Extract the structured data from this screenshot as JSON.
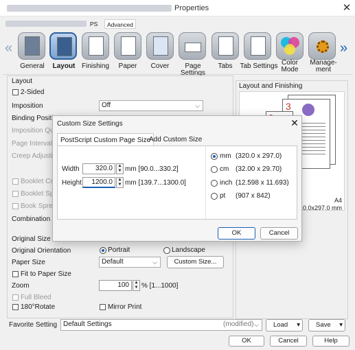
{
  "window": {
    "title": "Properties",
    "close": "✕"
  },
  "top_tabs": [
    "PS",
    "Advanced"
  ],
  "icons": [
    {
      "label": "General",
      "icon": "general-icon"
    },
    {
      "label": "Layout",
      "icon": "layout-icon",
      "selected": true
    },
    {
      "label": "Finishing",
      "icon": "finishing-icon"
    },
    {
      "label": "Paper",
      "icon": "paper-icon"
    },
    {
      "label": "Cover",
      "icon": "cover-icon"
    },
    {
      "label": "Page Settings",
      "icon": "page-settings-icon"
    },
    {
      "label": "Tabs",
      "icon": "tabs-icon"
    },
    {
      "label": "Tab Settings",
      "icon": "tab-settings-icon"
    },
    {
      "label": "Color Mode",
      "label2": "Mode",
      "label1": "Color",
      "icon": "color-mode-icon"
    },
    {
      "label": "Manage-ment",
      "label1": "Manage-",
      "label2": "ment",
      "icon": "management-icon"
    }
  ],
  "layout": {
    "section": "Layout",
    "two_sided": "2-Sided",
    "imposition_label": "Imposition",
    "imposition_value": "Off",
    "binding_position": "Binding Position",
    "imposition_qty": "Imposition Qu",
    "page_interval": "Page Interval",
    "creep_adjust": "Creep Adjusti",
    "booklet_cover": "Booklet Co",
    "booklet_split": "Booklet Spl",
    "book_spread": "Book Sprea",
    "combination": "Combination",
    "original_size": "Original Size",
    "original_orientation": "Original Orientation",
    "portrait": "Portrait",
    "landscape": "Landscape",
    "paper_size": "Paper Size",
    "paper_size_value": "Default",
    "custom_size_btn": "Custom Size...",
    "fit_to_paper": "Fit to Paper Size",
    "zoom": "Zoom",
    "zoom_value": "100",
    "zoom_range": "% [1...1000]",
    "full_bleed": "Full Bleed",
    "rotate": "180°Rotate",
    "mirror": "Mirror Print"
  },
  "preview": {
    "section": "Layout and Finishing",
    "paper": "A4",
    "size": "210.0x297.0 mm",
    "page_numbers": [
      "3",
      "2"
    ]
  },
  "favorite": {
    "label": "Favorite Setting",
    "value": "Default Settings",
    "modified": "(modified)",
    "load": "Load",
    "save": "Save"
  },
  "footer": {
    "ok": "OK",
    "cancel": "Cancel",
    "help": "Help"
  },
  "dialog": {
    "title": "Custom Size Settings",
    "tabs": [
      "PostScript Custom Page Size",
      "Add Custom Size"
    ],
    "width_label": "Width",
    "width_value": "320.0",
    "width_range": "mm [90.0...330.2]",
    "height_label": "Height",
    "height_value": "1200.0",
    "height_range": "mm [139.7...1300.0]",
    "units": [
      {
        "unit": "mm",
        "value": "(320.0 x 297.0)",
        "selected": true
      },
      {
        "unit": "cm",
        "value": "(32.00 x 29.70)"
      },
      {
        "unit": "inch",
        "value": "(12.598 x 11.693)"
      },
      {
        "unit": "pt",
        "value": "(907 x 842)"
      }
    ],
    "ok": "OK",
    "cancel": "Cancel"
  }
}
